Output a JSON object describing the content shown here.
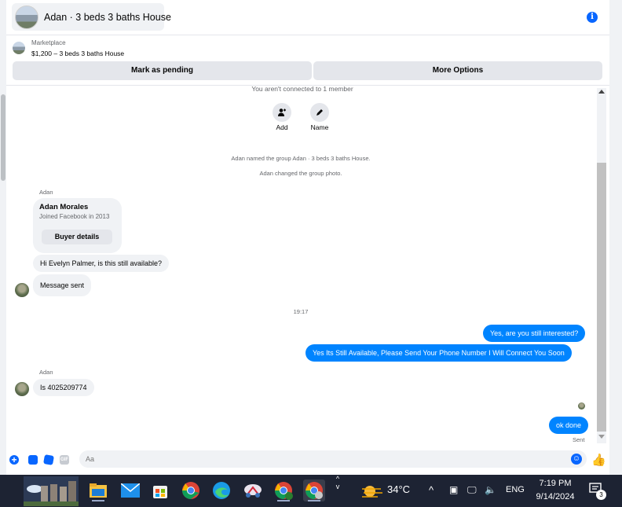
{
  "header": {
    "title": "Adan · 3 beds 3 baths House",
    "info_icon": "info-icon"
  },
  "marketplace": {
    "label": "Marketplace",
    "listing": "$1,200 – 3 beds 3 baths House"
  },
  "actions": {
    "mark_pending": "Mark as pending",
    "more_options": "More Options"
  },
  "conversation": {
    "connection_notice": "You aren't connected to 1 member",
    "add_label": "Add",
    "name_label": "Name",
    "event_named": "Adan named the group Adan · 3 beds 3 baths House.",
    "event_photo": "Adan changed the group photo.",
    "buyer": {
      "sender": "Adan",
      "name": "Adan Morales",
      "joined": "Joined Facebook in 2013",
      "details_button": "Buyer details"
    },
    "msg1": "Hi Evelyn Palmer, is this still available?",
    "msg2": "Message sent",
    "timestamp": "19:17",
    "out1": "Yes, are you still interested?",
    "out2": "Yes Its Still Available, Please Send Your Phone Number I Will Connect You Soon",
    "sender2": "Adan",
    "msg3": "Is 4025209774",
    "out3": "ok done",
    "status": "Sent"
  },
  "composer": {
    "placeholder": "Aa",
    "gif_label": "GIF"
  },
  "taskbar": {
    "temperature": "34°C",
    "language": "ENG",
    "time": "7:19 PM",
    "date": "9/14/2024",
    "notification_count": "3"
  },
  "colors": {
    "accent": "#0866ff",
    "outgoing_bubble": "#0084ff",
    "incoming_bubble": "#f0f2f5",
    "taskbar": "#1d2333"
  }
}
